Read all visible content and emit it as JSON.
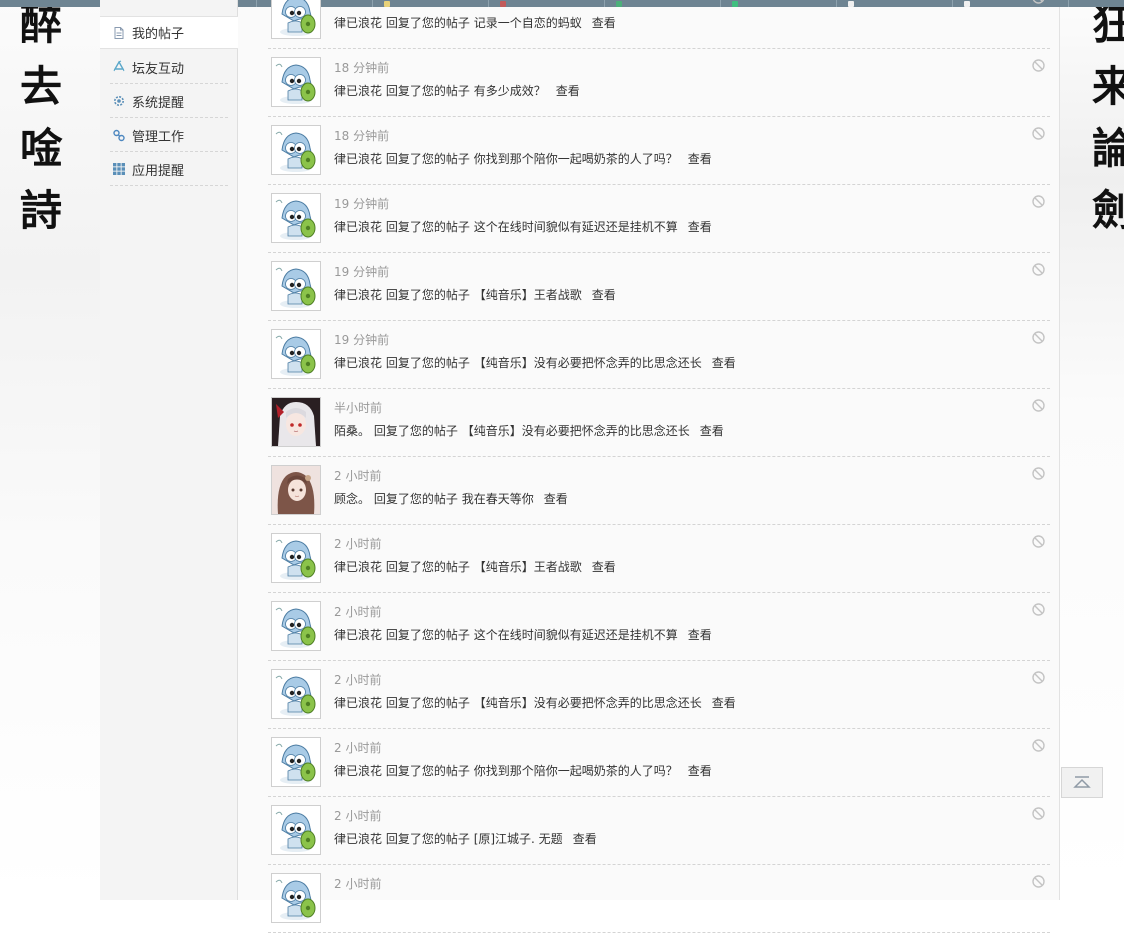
{
  "calligraphy": {
    "left": [
      "醉",
      "去",
      "唫",
      "詩"
    ],
    "right": [
      "狂",
      "来",
      "論",
      "劍"
    ]
  },
  "sidebar": {
    "items": [
      {
        "label": "我的帖子",
        "icon": "document-icon",
        "active": true
      },
      {
        "label": "坛友互动",
        "icon": "recycle-icon",
        "active": false
      },
      {
        "label": "系统提醒",
        "icon": "gear-icon",
        "active": false
      },
      {
        "label": "管理工作",
        "icon": "link-icon",
        "active": false
      },
      {
        "label": "应用提醒",
        "icon": "grid-icon",
        "active": false
      }
    ]
  },
  "notices": [
    {
      "time": "",
      "user": "律已浪花",
      "action": "回复了您的帖子",
      "subject": "记录一个自恋的蚂蚁",
      "view": "查看",
      "avatar": "mascot"
    },
    {
      "time": "18 分钟前",
      "user": "律已浪花",
      "action": "回复了您的帖子",
      "subject": "有多少成效？",
      "view": "查看",
      "avatar": "mascot"
    },
    {
      "time": "18 分钟前",
      "user": "律已浪花",
      "action": "回复了您的帖子",
      "subject": "你找到那个陪你一起喝奶茶的人了吗？",
      "view": "查看",
      "avatar": "mascot"
    },
    {
      "time": "19 分钟前",
      "user": "律已浪花",
      "action": "回复了您的帖子",
      "subject": "这个在线时间貌似有延迟还是挂机不算",
      "view": "查看",
      "avatar": "mascot"
    },
    {
      "time": "19 分钟前",
      "user": "律已浪花",
      "action": "回复了您的帖子",
      "subject": "【纯音乐】王者战歌",
      "view": "查看",
      "avatar": "mascot"
    },
    {
      "time": "19 分钟前",
      "user": "律已浪花",
      "action": "回复了您的帖子",
      "subject": "【纯音乐】没有必要把怀念弄的比思念还长",
      "view": "查看",
      "avatar": "mascot"
    },
    {
      "time": "半小时前",
      "user": "陌桑。",
      "action": "回复了您的帖子",
      "subject": "【纯音乐】没有必要把怀念弄的比思念还长",
      "view": "查看",
      "avatar": "anime-girl-red"
    },
    {
      "time": "2 小时前",
      "user": "顾念。",
      "action": "回复了您的帖子",
      "subject": "我在春天等你",
      "view": "查看",
      "avatar": "anime-girl-brown"
    },
    {
      "time": "2 小时前",
      "user": "律已浪花",
      "action": "回复了您的帖子",
      "subject": "【纯音乐】王者战歌",
      "view": "查看",
      "avatar": "mascot"
    },
    {
      "time": "2 小时前",
      "user": "律已浪花",
      "action": "回复了您的帖子",
      "subject": "这个在线时间貌似有延迟还是挂机不算",
      "view": "查看",
      "avatar": "mascot"
    },
    {
      "time": "2 小时前",
      "user": "律已浪花",
      "action": "回复了您的帖子",
      "subject": "【纯音乐】没有必要把怀念弄的比思念还长",
      "view": "查看",
      "avatar": "mascot"
    },
    {
      "time": "2 小时前",
      "user": "律已浪花",
      "action": "回复了您的帖子",
      "subject": "你找到那个陪你一起喝奶茶的人了吗？",
      "view": "查看",
      "avatar": "mascot"
    },
    {
      "time": "2 小时前",
      "user": "律已浪花",
      "action": "回复了您的帖子",
      "subject": "[原]江城子. 无题",
      "view": "查看",
      "avatar": "mascot"
    },
    {
      "time": "2 小时前",
      "user": "",
      "action": "",
      "subject": "",
      "view": "",
      "avatar": "mascot"
    }
  ],
  "colors": {
    "topstrip": "#6e8492",
    "time_text": "#999999",
    "body_text": "#333333",
    "divider": "#d4d4d4"
  }
}
